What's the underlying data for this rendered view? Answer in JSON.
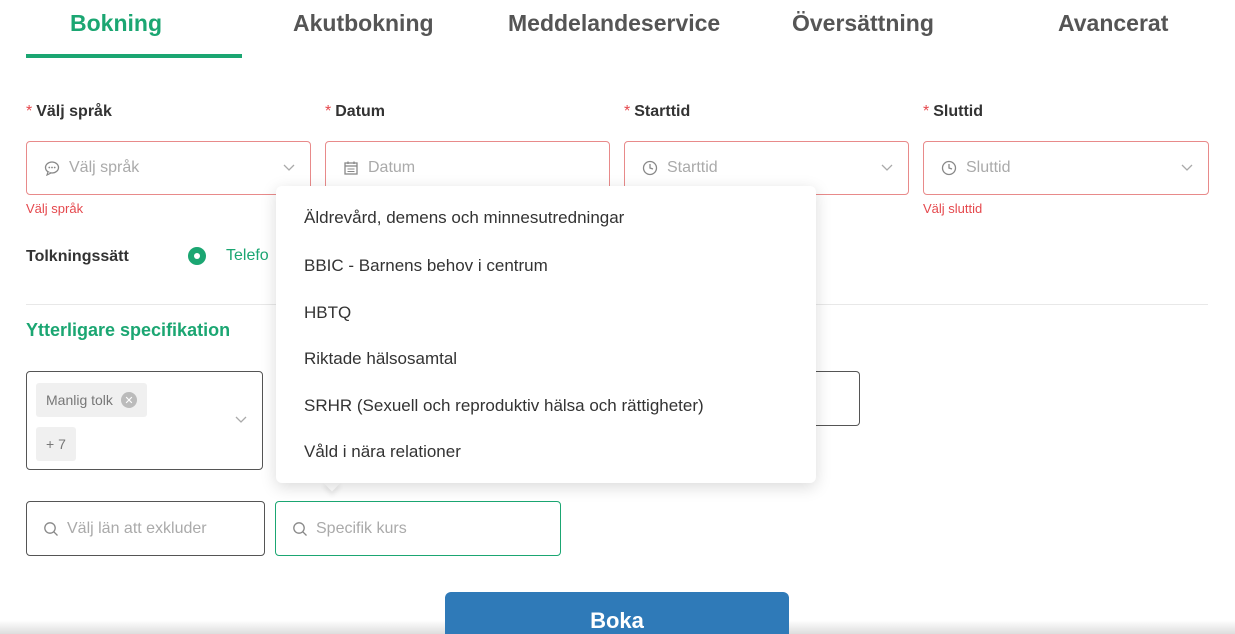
{
  "tabs": [
    {
      "label": "Bokning",
      "active": true
    },
    {
      "label": "Akutbokning"
    },
    {
      "label": "Meddelandeservice"
    },
    {
      "label": "Översättning"
    },
    {
      "label": "Avancerat"
    }
  ],
  "fields": {
    "language": {
      "label": "Välj språk",
      "placeholder": "Välj språk",
      "error": "Välj språk",
      "icon": "chat-icon"
    },
    "date": {
      "label": "Datum",
      "placeholder": "Datum",
      "icon": "calendar-icon"
    },
    "start": {
      "label": "Starttid",
      "placeholder": "Starttid",
      "icon": "clock-icon"
    },
    "end": {
      "label": "Sluttid",
      "placeholder": "Sluttid",
      "error": "Välj sluttid",
      "icon": "clock-icon"
    },
    "required_mark": "*"
  },
  "tolkningssatt": {
    "label": "Tolkningssätt",
    "option": "Telefo"
  },
  "section": {
    "title": "Ytterligare specifikation"
  },
  "multi": {
    "tag": "Manlig tolk",
    "more": "+ 7"
  },
  "search": {
    "lan_placeholder": "Välj län att exkluder",
    "kurs_placeholder": "Specifik kurs"
  },
  "dropdown": {
    "options": [
      "Äldrevård, demens och minnesutredningar",
      "BBIC - Barnens behov i centrum",
      "HBTQ",
      "Riktade hälsosamtal",
      "SRHR (Sexuell och reproduktiv hälsa och rättigheter)",
      "Våld i nära relationer"
    ]
  },
  "actions": {
    "book": "Boka"
  },
  "colors": {
    "accent": "#1ba672",
    "error": "#e5484d",
    "primary_button": "#2f7ab8"
  }
}
